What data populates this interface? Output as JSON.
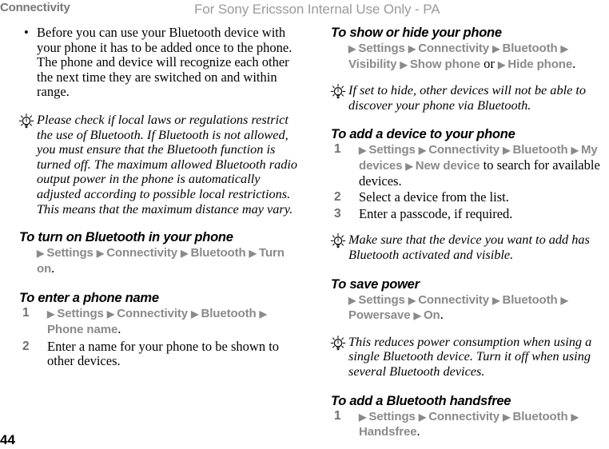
{
  "page": {
    "running_head": "Connectivity",
    "watermark": "For Sony Ericsson Internal Use Only - PA",
    "folio": "44",
    "arrow_glyph": "▶",
    "bullet_glyph": "•",
    "note_icon": "lightbulb-icon",
    "colors": {
      "menu_gray": "#8a8a8a",
      "running_head_gray": "#777777",
      "watermark_gray": "#9a9a9a",
      "body_black": "#000000"
    }
  },
  "left_column": {
    "bullet": "Before you can use your Bluetooth device with your phone it has to be added once to the phone. The phone and device will recognize each other the next time they are switched on and within range.",
    "note": "Please check if local laws or regulations restrict the use of Bluetooth. If Bluetooth is not allowed, you must ensure that the Bluetooth function is turned off. The maximum allowed Bluetooth radio output power in the phone is automatically adjusted according to possible local restrictions. This means that the maximum distance may vary.",
    "section_turn_on": {
      "heading": "To turn on Bluetooth in your phone",
      "path": [
        "Settings",
        "Connectivity",
        "Bluetooth",
        "Turn on"
      ],
      "terminator": "."
    },
    "section_phone_name": {
      "heading": "To enter a phone name",
      "steps": [
        {
          "num": "1",
          "path": [
            "Settings",
            "Connectivity",
            "Bluetooth",
            "Phone name"
          ],
          "terminator": "."
        },
        {
          "num": "2",
          "text": "Enter a name for your phone to be shown to other devices."
        }
      ]
    }
  },
  "right_column": {
    "section_show_hide": {
      "heading": "To show or hide your phone",
      "path_a": [
        "Settings",
        "Connectivity",
        "Bluetooth",
        "Visibility",
        "Show phone"
      ],
      "conjunction": " or ",
      "path_b": [
        "Hide phone"
      ],
      "terminator": "."
    },
    "note_hide": "If set to hide, other devices will not be able to discover your phone via Bluetooth.",
    "section_add_device": {
      "heading": "To add a device to your phone",
      "steps": [
        {
          "num": "1",
          "path": [
            "Settings",
            "Connectivity",
            "Bluetooth",
            "My devices",
            "New device"
          ],
          "trailing_text": " to search for available devices."
        },
        {
          "num": "2",
          "text": "Select a device from the list."
        },
        {
          "num": "3",
          "text": "Enter a passcode, if required."
        }
      ]
    },
    "note_activate": "Make sure that the device you want to add has Bluetooth activated and visible.",
    "section_save_power": {
      "heading": "To save power",
      "path": [
        "Settings",
        "Connectivity",
        "Bluetooth",
        "Powersave",
        "On"
      ],
      "terminator": "."
    },
    "note_power": "This reduces power consumption when using a single Bluetooth device. Turn it off when using several Bluetooth devices.",
    "section_handsfree": {
      "heading": "To add a Bluetooth handsfree",
      "steps": [
        {
          "num": "1",
          "path": [
            "Settings",
            "Connectivity",
            "Bluetooth",
            "Handsfree"
          ],
          "terminator": "."
        }
      ]
    }
  }
}
